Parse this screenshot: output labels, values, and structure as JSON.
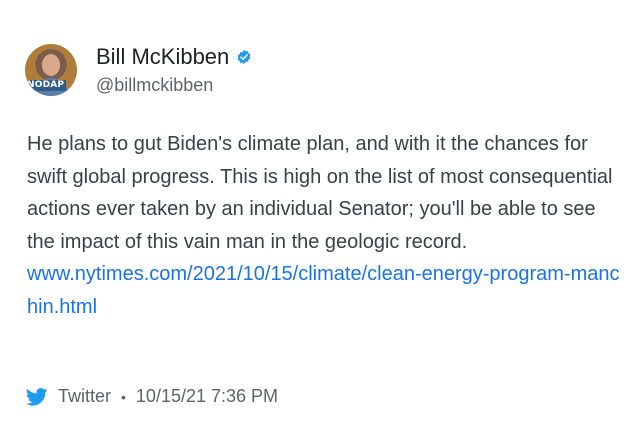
{
  "author": {
    "display_name": "Bill McKibben",
    "handle": "@billmckibben",
    "avatar_badge": "NODAP",
    "verified": true,
    "verified_color": "#1d9bf0"
  },
  "tweet": {
    "text": "He plans to gut Biden's climate plan, and with it the chances for swift global progress. This is high on the list of most consequential actions ever taken by an individual Senator; you'll be able to see the impact of this vain man in the geologic record.",
    "link": "www.nytimes.com/2021/10/15/climate/clean-energy-program-manchin.html",
    "link_color": "#1a73e8"
  },
  "footer": {
    "source_icon": "twitter-bird-icon",
    "source": "Twitter",
    "separator": "•",
    "timestamp": "10/15/21 7:36 PM",
    "icon_color": "#1d9bf0"
  }
}
